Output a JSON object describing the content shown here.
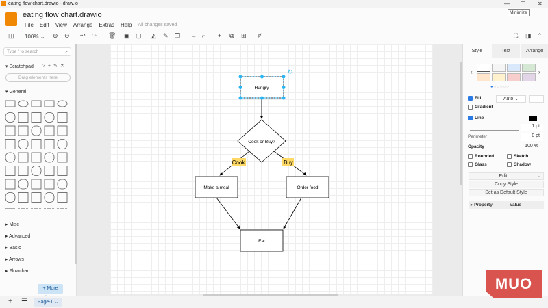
{
  "window": {
    "title": "eating flow chart.drawio - draw.io",
    "tooltip": "Minimize"
  },
  "header": {
    "filename": "eating flow chart.drawio",
    "menu": [
      "File",
      "Edit",
      "View",
      "Arrange",
      "Extras",
      "Help"
    ],
    "status": "All changes saved"
  },
  "toolbar": {
    "zoom": "100%"
  },
  "sidebar": {
    "search_placeholder": "Type / to search",
    "scratchpad": "Scratchpad",
    "drag_hint": "Drag elements here",
    "general": "General",
    "sections": [
      "Misc",
      "Advanced",
      "Basic",
      "Arrows",
      "Flowchart"
    ],
    "more_shapes": "+ More Shapes"
  },
  "diagram": {
    "nodes": {
      "start": "Hungry",
      "decision": "Cook or Buy?",
      "left": "Make a meal",
      "right": "Order food",
      "end": "Eat"
    },
    "edge_labels": {
      "left": "Cook",
      "right": "Buy"
    },
    "label_highlight": "#ffd966",
    "selection_color": "#29b6f2"
  },
  "format": {
    "tabs": [
      "Style",
      "Text",
      "Arrange"
    ],
    "swatches": [
      "#ffffff",
      "#f5f5f5",
      "#dae8fc",
      "#d5e8d4",
      "#ffe6cc",
      "#fff2cc",
      "#f8cecc",
      "#e1d5e7"
    ],
    "fill": "Fill",
    "fill_mode": "Auto",
    "gradient": "Gradient",
    "line": "Line",
    "line_width": "1 pt",
    "perimeter": "Perimeter",
    "perimeter_value": "0 pt",
    "opacity": "Opacity",
    "opacity_value": "100 %",
    "rounded": "Rounded",
    "sketch": "Sketch",
    "glass": "Glass",
    "shadow": "Shadow",
    "edit": "Edit",
    "copy_style": "Copy Style",
    "default_style": "Set as Default Style",
    "property": "Property",
    "value": "Value"
  },
  "footer": {
    "page": "Page-1"
  },
  "watermark": "MUO"
}
